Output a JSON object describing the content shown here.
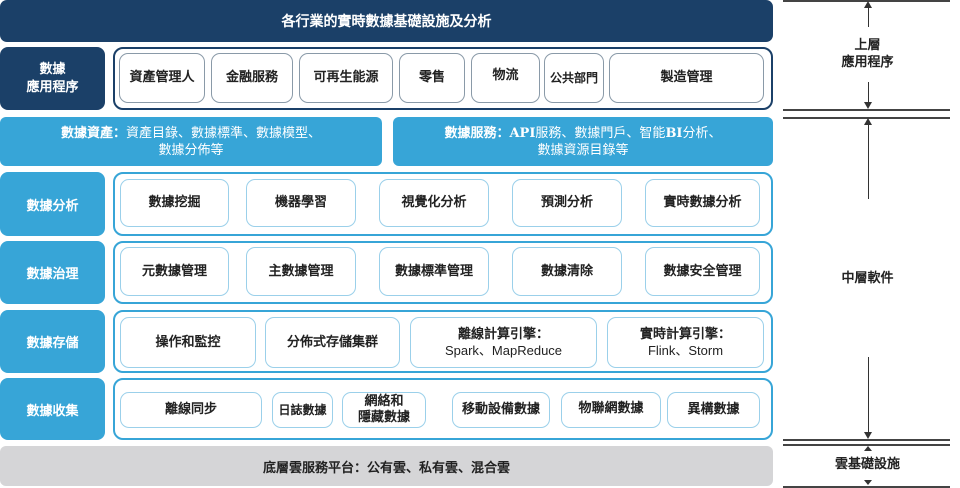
{
  "title": "各行業的實時數據基礎設施及分析",
  "apps": {
    "label_line1": "數據",
    "label_line2": "應用程序",
    "items": [
      "資產管理人",
      "金融服務",
      "可再生能源",
      "零售",
      "物流",
      "公共部門",
      "製造管理"
    ]
  },
  "assets": {
    "line1_bold": "數據資產：",
    "line1": "資產目錄、數據標準、數據模型、",
    "line2": "數據分佈等"
  },
  "services": {
    "line1_bold": "數據服務：API",
    "line1": "服務、數據門戶、智能",
    "bi": "BI",
    "line1_end": "分析、",
    "line2": "數據資源目錄等"
  },
  "analysis": {
    "label": "數據分析",
    "items": [
      "數據挖掘",
      "機器學習",
      "視覺化分析",
      "預測分析",
      "實時數據分析"
    ]
  },
  "governance": {
    "label": "數據治理",
    "items": [
      "元數據管理",
      "主數據管理",
      "數據標準管理",
      "數據清除",
      "數據安全管理"
    ]
  },
  "storage": {
    "label": "數據存儲",
    "items": [
      {
        "title": "操作和監控"
      },
      {
        "title": "分佈式存儲集群"
      },
      {
        "title": "離線計算引擎：",
        "sub": "Spark、MapReduce"
      },
      {
        "title": "實時計算引擎：",
        "sub": "Flink、Storm"
      }
    ]
  },
  "collection": {
    "label": "數據收集",
    "items": [
      {
        "title": "離線同步"
      },
      {
        "title": "日誌數據"
      },
      {
        "title": "網絡和",
        "sub": "隱藏數據"
      },
      {
        "title": "移動設備數據"
      },
      {
        "title": "物聯網數據"
      },
      {
        "title": "異構數據"
      }
    ]
  },
  "bottom": "底層雲服務平台：公有雲、私有雲、混合雲",
  "side": {
    "upper_line1": "上層",
    "upper_line2": "應用程序",
    "middle": "中層軟件",
    "cloud": "雲基礎設施"
  }
}
